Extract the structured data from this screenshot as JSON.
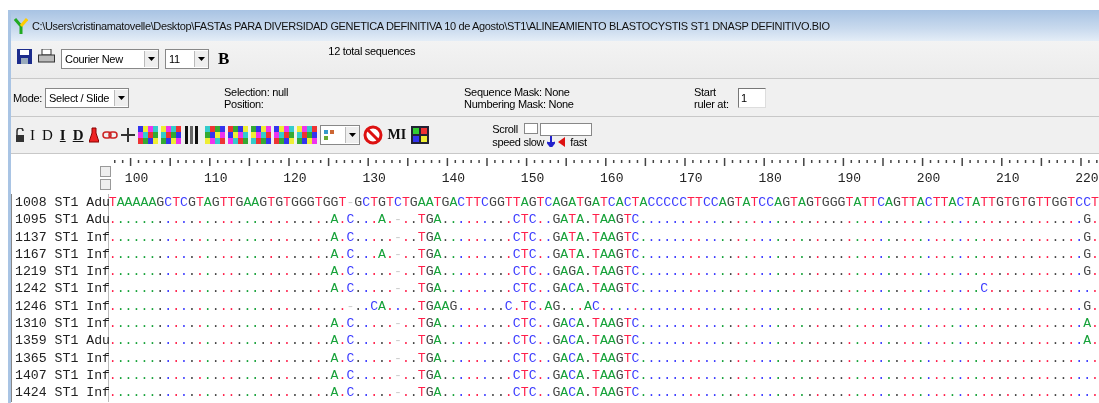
{
  "window": {
    "title": "C:\\Users\\cristinamatovelle\\Desktop\\FASTAs PARA DIVERSIDAD GENETICA DEFINITIVA 10 de Agosto\\ST1\\ALINEAMIENTO BLASTOCYSTIS ST1 DNASP DEFINITIVO.BIO"
  },
  "toolbar": {
    "font": "Courier New",
    "size": "11",
    "bold_label": "B",
    "total": "12 total sequences"
  },
  "status": {
    "mode_label": "Mode:",
    "mode": "Select / Slide",
    "selection": "Selection: null",
    "position": "Position:",
    "sequence_mask": "Sequence Mask: None",
    "numbering_mask": "Numbering Mask: None",
    "start_label": "Start ruler at:",
    "start_value": "1"
  },
  "tools": [
    {
      "kind": "lock"
    },
    {
      "kind": "glyph",
      "label": "I",
      "underline": false
    },
    {
      "kind": "glyph",
      "label": "D",
      "underline": false
    },
    {
      "kind": "glyph",
      "label": "I",
      "underline": true
    },
    {
      "kind": "glyph",
      "label": "D",
      "underline": true
    },
    {
      "kind": "flask"
    },
    {
      "kind": "link"
    },
    {
      "kind": "cross"
    },
    {
      "kind": "mosaic"
    },
    {
      "kind": "mosaic"
    },
    {
      "kind": "bars"
    },
    {
      "kind": "mosaic"
    },
    {
      "kind": "mosaic"
    },
    {
      "kind": "mosaic"
    },
    {
      "kind": "mosaic"
    },
    {
      "kind": "mosaic"
    },
    {
      "kind": "select"
    },
    {
      "kind": "no-sign"
    },
    {
      "kind": "glyph",
      "label": "MI",
      "underline": false
    },
    {
      "kind": "grid"
    }
  ],
  "scroll": {
    "label": "Scroll",
    "slow": "speed slow",
    "fast": "fast"
  },
  "ruler": {
    "labels": [
      "100",
      "110",
      "120",
      "130",
      "140",
      "150",
      "160",
      "170",
      "180",
      "190",
      "200",
      "210",
      "220"
    ]
  },
  "rows": [
    {
      "name": "1008 ST1 Adu",
      "sequence": "TAAAAAGCTCGTAGTTGAAGTGTGGGTGGT-GCTGTCTGAATGACTTCGGTTAGTCAGATGATCACTACCCCCTTCCAGTATCCAGTAGTGGGTATTCAGTTACTTACTATTGTGTGTTGGTCCT"
    },
    {
      "name": "1095 ST1 Adu",
      "sequence": "............................A.C...A.-..TGA.........CTC..GATA.TAAGTC........................................................G."
    },
    {
      "name": "1137 ST1 Inf",
      "sequence": "............................A.C.....-..TGA.........CTC..GATA.TAAGTC........................................................G."
    },
    {
      "name": "1167 ST1 Inf",
      "sequence": "............................A.C...A.-..TGA.........CTC..GATA.TAAGTC........................................................G."
    },
    {
      "name": "1219 ST1 Inf",
      "sequence": "............................A.C.....-..TGA.........CTC..GAGA.TAAGTC........................................................G."
    },
    {
      "name": "1242 ST1 Inf",
      "sequence": "............................A.C.....-..TGA.........CTC..GACA.TAAGTC...........................................C.............."
    },
    {
      "name": "1246 ST1 Inf",
      "sequence": "..............................-..CA....TGAAG......C.TC.AG...AC.............................................................G."
    },
    {
      "name": "1310 ST1 Inf",
      "sequence": "............................A.C.....-..TGA.........CTC..GACA.TAAGTC........................................................A."
    },
    {
      "name": "1359 ST1 Adu",
      "sequence": "............................A.C.....-..TGA.........CTC..GACA.TAAGTC........................................................A."
    },
    {
      "name": "1365 ST1 Inf",
      "sequence": "............................A.C.....-..TGA.........CTC..GACA.TAAGTC.........................................................."
    },
    {
      "name": "1407 ST1 Inf",
      "sequence": "............................A.C.....-..TGA.........CTC..GACA.TAAGTC.........................................................."
    },
    {
      "name": "1424 ST1 Inf",
      "sequence": "............................A.C.....-..TGA.........CTC..GACA.TAAGTC.........................................................."
    }
  ]
}
